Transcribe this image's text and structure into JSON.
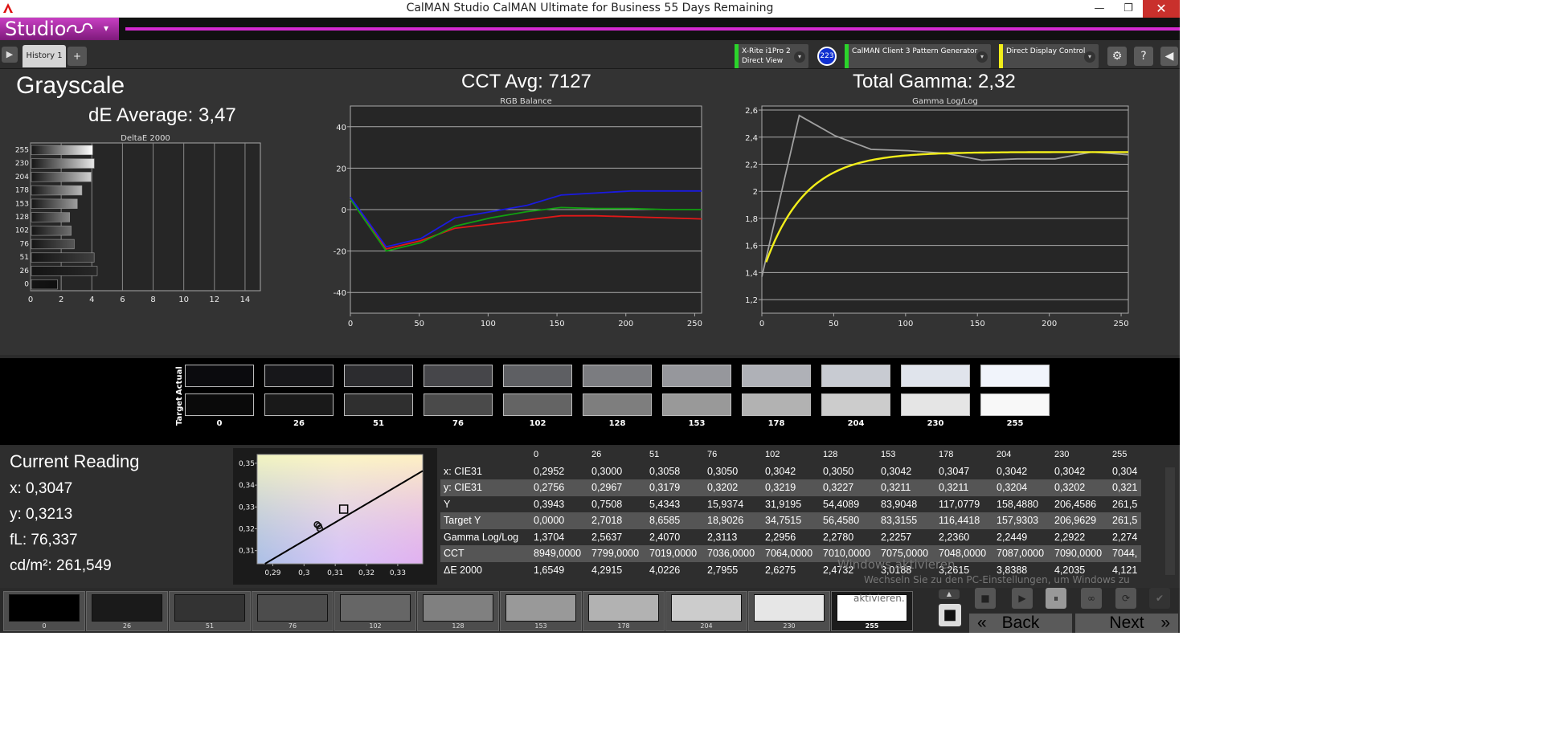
{
  "window": {
    "title": "CalMAN Studio CalMAN Ultimate for Business 55 Days Remaining",
    "minimize": "—",
    "maximize": "❐",
    "close": "✕"
  },
  "brand": {
    "logo": "Studio",
    "menu": "▾"
  },
  "toolbar": {
    "play": "▶",
    "tab": "History 1",
    "add": "+",
    "devices": [
      {
        "line1": "X-Rite i1Pro 2",
        "line2": "Direct View",
        "stripe": "#2bd42b"
      },
      {
        "line1": "CalMAN Client 3 Pattern Generator",
        "line2": "",
        "stripe": "#2bd42b"
      },
      {
        "line1": "Direct Display Control",
        "line2": "",
        "stripe": "#f2ee1a"
      }
    ],
    "badge": "223",
    "dropdown": "▾",
    "settings": "⚙",
    "help": "?",
    "collapse": "◀"
  },
  "grayscale": {
    "title": "Grayscale",
    "de_average": "dE Average: 3,47",
    "cct_avg": "CCT Avg: 7127",
    "total_gamma": "Total Gamma: 2,32"
  },
  "chart_data": [
    {
      "type": "bar",
      "title": "DeltaE 2000",
      "orientation": "horizontal",
      "categories": [
        "255",
        "230",
        "204",
        "178",
        "153",
        "128",
        "102",
        "76",
        "51",
        "26",
        "0"
      ],
      "values": [
        4.0,
        4.1,
        3.9,
        3.3,
        3.0,
        2.5,
        2.6,
        2.8,
        4.1,
        4.3,
        1.7
      ],
      "xlim": [
        0,
        15
      ],
      "xticks": [
        "0",
        "2",
        "4",
        "6",
        "8",
        "10",
        "12",
        "14"
      ],
      "grid": true
    },
    {
      "type": "line",
      "title": "RGB Balance",
      "x": [
        0,
        26,
        51,
        76,
        102,
        128,
        153,
        178,
        204,
        230,
        255
      ],
      "series": [
        {
          "color": "#e01818",
          "values": [
            5,
            -19,
            -15,
            -9,
            -7,
            -5,
            -3,
            -3,
            -3.5,
            -4,
            -4.5
          ]
        },
        {
          "color": "#10a010",
          "values": [
            5,
            -20,
            -16,
            -8,
            -4,
            -1,
            1,
            0.5,
            0.5,
            0,
            0
          ]
        },
        {
          "color": "#1a1ae0",
          "values": [
            6,
            -18,
            -14,
            -4,
            -1,
            2,
            7,
            8,
            9,
            9,
            9
          ]
        }
      ],
      "xlim": [
        0,
        255
      ],
      "ylim": [
        -50,
        50
      ],
      "xticks": [
        "0",
        "50",
        "100",
        "150",
        "200",
        "250"
      ],
      "yticks": [
        "40",
        "20",
        "0",
        "-20",
        "-40"
      ],
      "grid": true
    },
    {
      "type": "line",
      "title": "Gamma Log/Log",
      "x_measured": [
        0,
        26,
        51,
        76,
        102,
        128,
        153,
        178,
        204,
        230,
        255
      ],
      "series": [
        {
          "color": "#a0a0a0",
          "values": [
            1.37,
            2.56,
            2.41,
            2.31,
            2.3,
            2.28,
            2.23,
            2.24,
            2.24,
            2.29,
            2.27
          ]
        },
        {
          "color": "#f2ee1a",
          "curve": "target",
          "values": [
            1.38,
            1.98,
            2.1,
            2.16,
            2.2,
            2.22,
            2.24,
            2.25,
            2.26,
            2.27,
            2.275
          ]
        }
      ],
      "xlim": [
        0,
        255
      ],
      "ylim": [
        1.1,
        2.63
      ],
      "xticks": [
        "0",
        "50",
        "100",
        "150",
        "200",
        "250"
      ],
      "yticks": [
        "2,6",
        "2,4",
        "2,2",
        "2",
        "1,8",
        "1,6",
        "1,4",
        "1,2"
      ],
      "grid": true
    }
  ],
  "swatches": {
    "actual_label": "Actual",
    "target_label": "Target",
    "labels": [
      "0",
      "26",
      "51",
      "76",
      "102",
      "128",
      "153",
      "178",
      "204",
      "230",
      "255"
    ],
    "actual_colors": [
      "#0b0b0e",
      "#17171a",
      "#2c2c2f",
      "#46464a",
      "#5e5f63",
      "#7b7c80",
      "#96979c",
      "#afb1b7",
      "#c8cbd2",
      "#e0e4ec",
      "#f1f4fb"
    ],
    "target_colors": [
      "#0a0a0a",
      "#191919",
      "#2f2f2f",
      "#4a4a4a",
      "#646464",
      "#7e7e7e",
      "#999999",
      "#b2b2b2",
      "#cccccc",
      "#e5e5e5",
      "#f8f8f8"
    ]
  },
  "current_reading": {
    "title": "Current Reading",
    "x": "x: 0,3047",
    "y": "y: 0,3213",
    "fl": "fL: 76,337",
    "cd": "cd/m²: 261,549"
  },
  "cie_chart": {
    "xticks": [
      "0,29",
      "0,3",
      "0,31",
      "0,32",
      "0,33"
    ],
    "yticks": [
      "0,35",
      "0,34",
      "0,33",
      "0,32",
      "0,31"
    ],
    "xlim": [
      0.285,
      0.338
    ],
    "ylim": [
      0.304,
      0.354
    ],
    "target": {
      "x": 0.3127,
      "y": 0.329
    },
    "measured": [
      {
        "x": 0.3047,
        "y": 0.3213
      },
      {
        "x": 0.305,
        "y": 0.3202
      },
      {
        "x": 0.3042,
        "y": 0.3219
      }
    ]
  },
  "table": {
    "headers": [
      "",
      "0",
      "26",
      "51",
      "76",
      "102",
      "128",
      "153",
      "178",
      "204",
      "230",
      "255"
    ],
    "rows": [
      [
        "x: CIE31",
        "0,2952",
        "0,3000",
        "0,3058",
        "0,3050",
        "0,3042",
        "0,3050",
        "0,3042",
        "0,3047",
        "0,3042",
        "0,3042",
        "0,304"
      ],
      [
        "y: CIE31",
        "0,2756",
        "0,2967",
        "0,3179",
        "0,3202",
        "0,3219",
        "0,3227",
        "0,3211",
        "0,3211",
        "0,3204",
        "0,3202",
        "0,321"
      ],
      [
        "Y",
        "0,3943",
        "0,7508",
        "5,4343",
        "15,9374",
        "31,9195",
        "54,4089",
        "83,9048",
        "117,0779",
        "158,4880",
        "206,4586",
        "261,5"
      ],
      [
        "Target Y",
        "0,0000",
        "2,7018",
        "8,6585",
        "18,9026",
        "34,7515",
        "56,4580",
        "83,3155",
        "116,4418",
        "157,9303",
        "206,9629",
        "261,5"
      ],
      [
        "Gamma Log/Log",
        "1,3704",
        "2,5637",
        "2,4070",
        "2,3113",
        "2,2956",
        "2,2780",
        "2,2257",
        "2,2360",
        "2,2449",
        "2,2922",
        "2,274"
      ],
      [
        "CCT",
        "8949,0000",
        "7799,0000",
        "7019,0000",
        "7036,0000",
        "7064,0000",
        "7010,0000",
        "7075,0000",
        "7048,0000",
        "7087,0000",
        "7090,0000",
        "7044,"
      ],
      [
        "ΔE 2000",
        "1,6549",
        "4,2915",
        "4,0226",
        "2,7955",
        "2,6275",
        "2,4732",
        "3,0188",
        "3,2615",
        "3,8388",
        "4,2035",
        "4,121"
      ]
    ]
  },
  "watermark": {
    "line1": "Windows aktivieren",
    "line2": "Wechseln Sie zu den PC-Einstellungen, um Windows zu",
    "line3": "aktivieren."
  },
  "patch_strip": {
    "labels": [
      "0",
      "26",
      "51",
      "76",
      "102",
      "128",
      "153",
      "178",
      "204",
      "230",
      "255"
    ],
    "colors": [
      "#000000",
      "#1a1a1a",
      "#333333",
      "#4c4c4c",
      "#666666",
      "#808080",
      "#999999",
      "#b2b2b2",
      "#cccccc",
      "#e6e6e6",
      "#ffffff"
    ]
  },
  "controls": {
    "up": "▲",
    "stop": "■",
    "back": "Back",
    "next": "Next",
    "back_icon": "«",
    "next_icon": "»",
    "icons": [
      "■",
      "▶",
      "⏸",
      "∞",
      "⟳",
      "✔"
    ]
  }
}
